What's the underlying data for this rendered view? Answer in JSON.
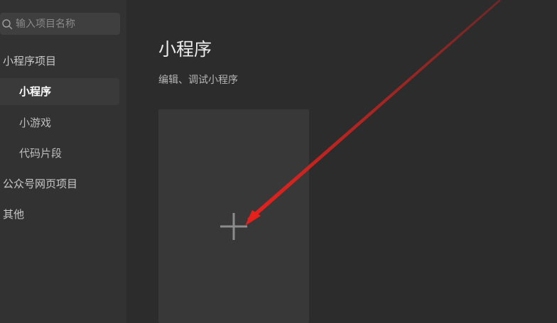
{
  "sidebar": {
    "search": {
      "placeholder": "输入项目名称",
      "icon": "search-icon"
    },
    "groups": [
      {
        "label": "小程序项目"
      },
      {
        "label": "公众号网页项目"
      },
      {
        "label": "其他"
      }
    ],
    "items": [
      {
        "label": "小程序",
        "active": true
      },
      {
        "label": "小游戏",
        "active": false
      },
      {
        "label": "代码片段",
        "active": false
      }
    ]
  },
  "main": {
    "title": "小程序",
    "subtitle": "编辑、调试小程序",
    "new_card": {
      "icon": "plus-icon"
    }
  },
  "annotation": {
    "color": "#e8201c",
    "icon": "arrow-annotation"
  },
  "colors": {
    "background": "#2c2c2c",
    "sidebar": "#323232",
    "card": "#383838",
    "active_item": "#3a3a3a"
  }
}
